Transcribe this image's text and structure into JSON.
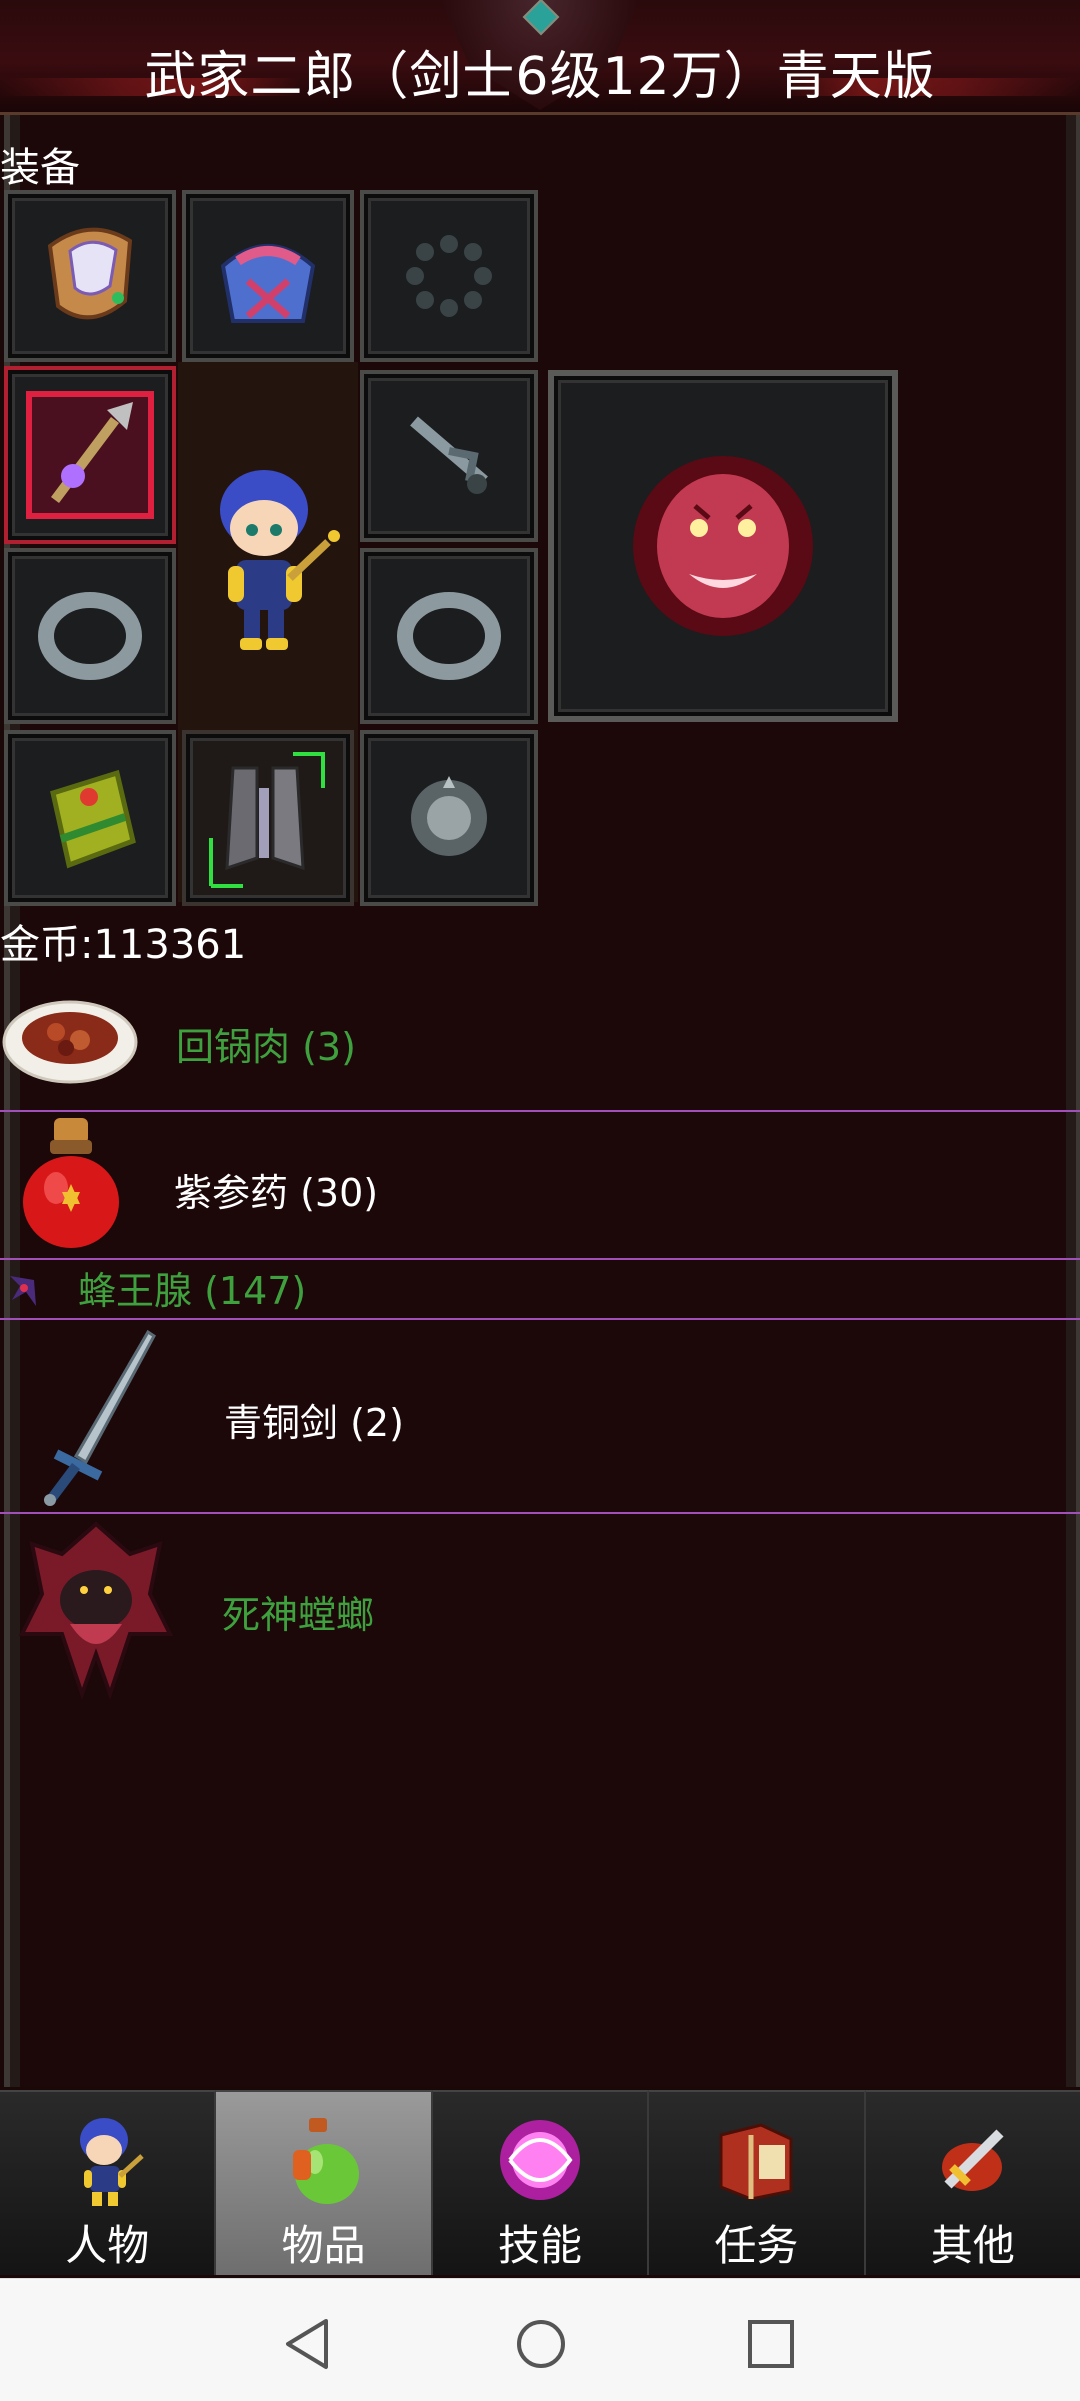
{
  "header": {
    "title": "武家二郎（剑士6级12万）青天版"
  },
  "equipment": {
    "section_label": "装备",
    "slots": [
      {
        "name": "helmet-slot",
        "icon": "helmet-icon"
      },
      {
        "name": "armor-slot",
        "icon": "robe-icon"
      },
      {
        "name": "necklace-slot",
        "icon": "bead-necklace-icon"
      },
      {
        "name": "weapon-slot",
        "icon": "staff-weapon-icon"
      },
      {
        "name": "amulet-slot",
        "icon": "dagger-amulet-icon"
      },
      {
        "name": "mount-slot",
        "icon": "tiger-head-icon"
      },
      {
        "name": "left-ring-slot",
        "icon": "ring-icon"
      },
      {
        "name": "right-ring-slot",
        "icon": "ring-icon"
      },
      {
        "name": "bracer-slot",
        "icon": "bracer-icon"
      },
      {
        "name": "boots-slot",
        "icon": "boots-icon"
      },
      {
        "name": "bracelet-slot",
        "icon": "silver-bracelet-icon"
      }
    ],
    "character_icon": "chibi-swordsman-icon"
  },
  "gold": {
    "text": "金币:113361"
  },
  "inventory": [
    {
      "label": "回锅肉 (3)",
      "icon": "braised-pork-icon",
      "color": "#3ea13e"
    },
    {
      "label": "紫参药 (30)",
      "icon": "red-potion-icon",
      "color": "#ffffff"
    },
    {
      "label": "蜂王腺 (147)",
      "icon": "bee-gland-icon",
      "color": "#3ea13e"
    },
    {
      "label": "青铜剑 (2)",
      "icon": "bronze-sword-icon",
      "color": "#ffffff"
    },
    {
      "label": "死神螳螂",
      "icon": "death-mantis-icon",
      "color": "#3ea13e"
    }
  ],
  "nav": {
    "tabs": [
      {
        "label": "人物",
        "icon": "character-icon"
      },
      {
        "label": "物品",
        "icon": "potion-bag-icon",
        "active": true
      },
      {
        "label": "技能",
        "icon": "skill-orb-icon"
      },
      {
        "label": "任务",
        "icon": "quest-book-icon"
      },
      {
        "label": "其他",
        "icon": "other-sword-icon"
      }
    ]
  },
  "system_bar": {
    "buttons": [
      "back-icon",
      "home-icon",
      "recents-icon"
    ]
  }
}
